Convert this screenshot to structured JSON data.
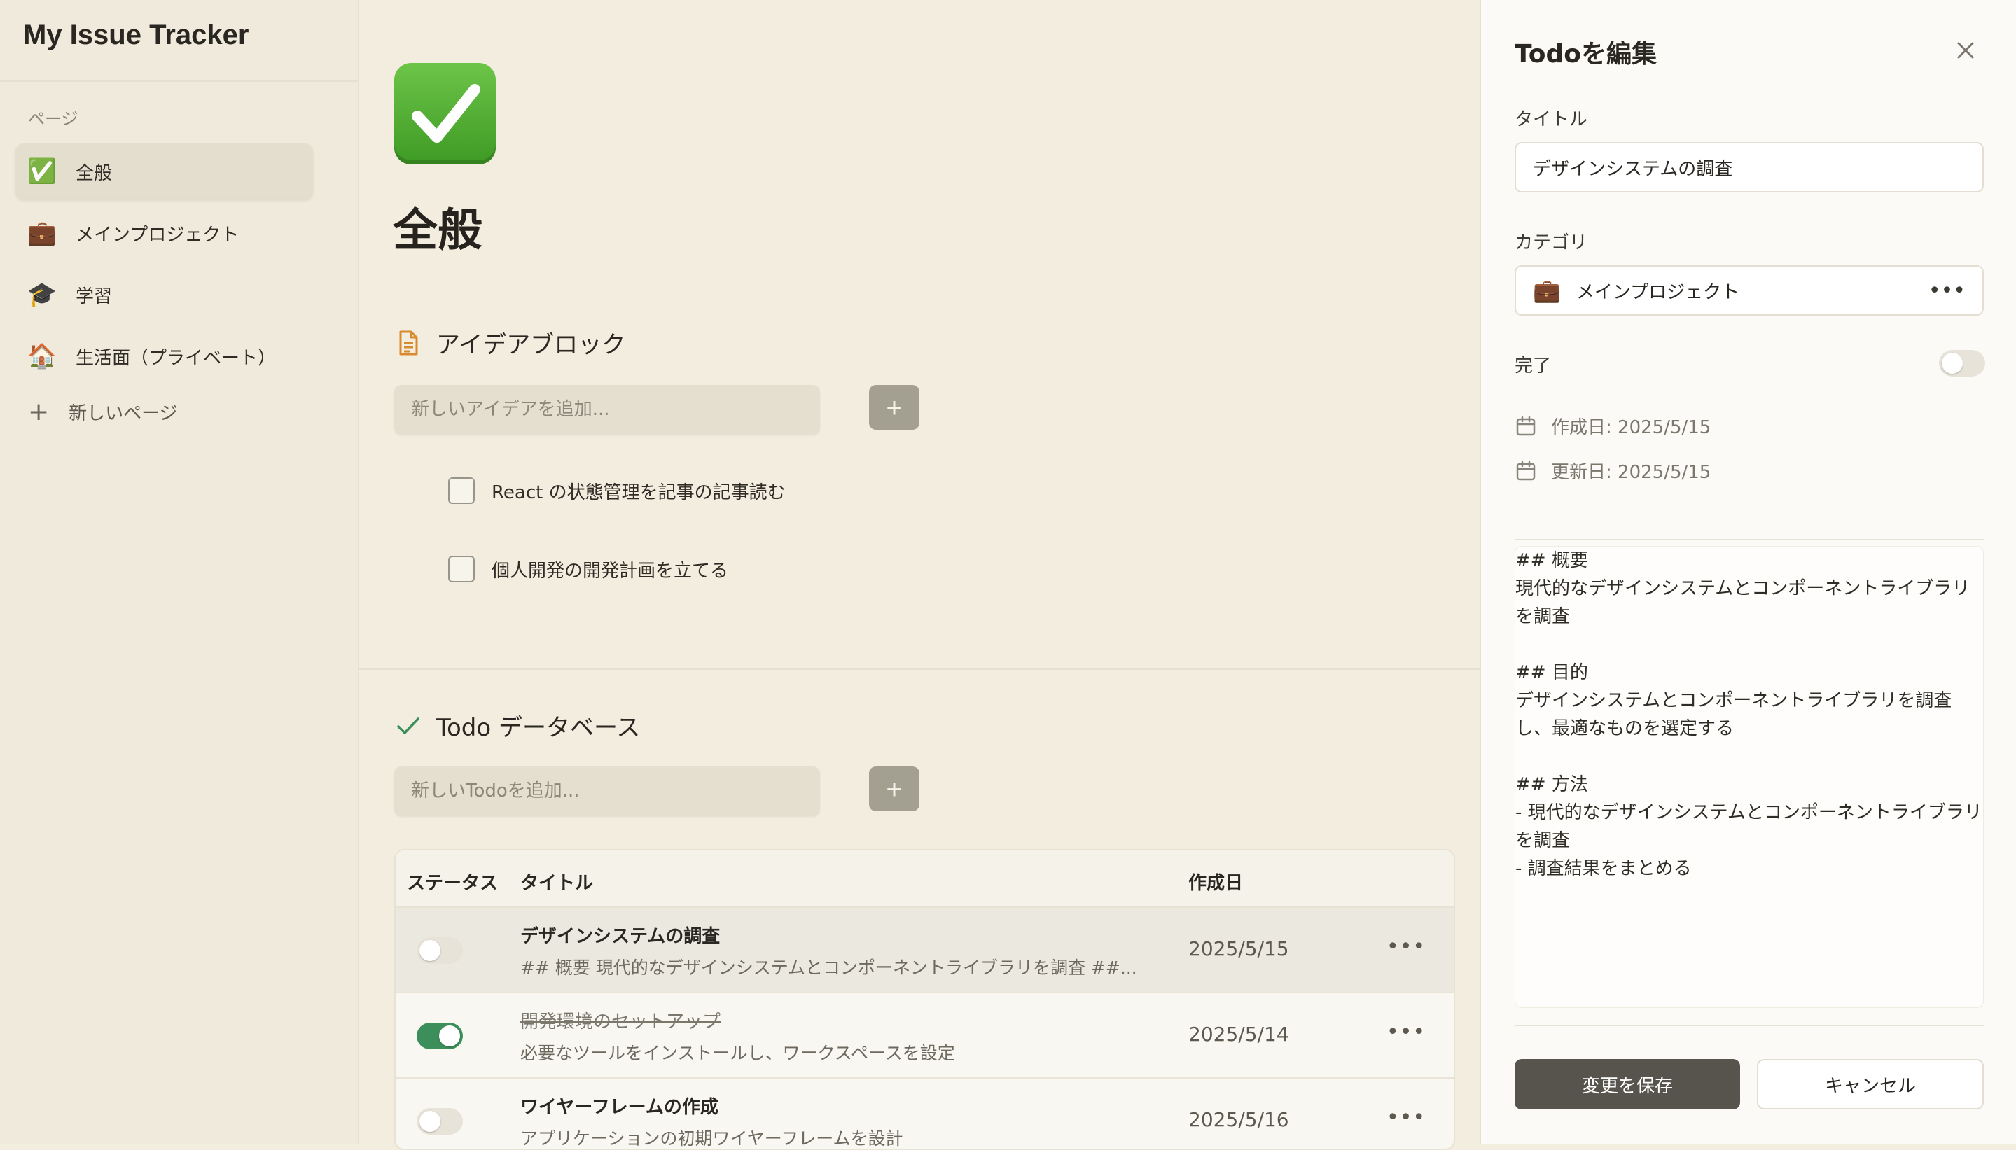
{
  "app": {
    "title": "My Issue Tracker"
  },
  "sidebar": {
    "section_label": "ページ",
    "items": [
      {
        "emoji": "✅",
        "label": "全般"
      },
      {
        "emoji": "💼",
        "label": "メインプロジェクト"
      },
      {
        "emoji": "🎓",
        "label": "学習"
      },
      {
        "emoji": "🏠",
        "label": "生活面（プライベート）"
      }
    ],
    "new_page_label": "新しいページ"
  },
  "main": {
    "page_emoji": "✅",
    "page_title": "全般",
    "idea_block": {
      "title": "アイデアブロック",
      "input_placeholder": "新しいアイデアを追加...",
      "items": [
        "React の状態管理を記事の記事読む",
        "個人開発の開発計画を立てる"
      ]
    },
    "todo_db": {
      "title": "Todo データベース",
      "input_placeholder": "新しいTodoを追加...",
      "columns": {
        "status": "ステータス",
        "title": "タイトル",
        "created": "作成日"
      },
      "rows": [
        {
          "title": "デザインシステムの調査",
          "description": "## 概要 現代的なデザインシステムとコンポーネントライブラリを調査 ##...",
          "created": "2025/5/15",
          "done": false
        },
        {
          "title": "開発環境のセットアップ",
          "description": "必要なツールをインストールし、ワークスペースを設定",
          "created": "2025/5/14",
          "done": true
        },
        {
          "title": "ワイヤーフレームの作成",
          "description": "アプリケーションの初期ワイヤーフレームを設計",
          "created": "2025/5/16",
          "done": false
        }
      ]
    }
  },
  "edit_panel": {
    "title": "Todoを編集",
    "title_label": "タイトル",
    "title_value": "デザインシステムの調査",
    "category_label": "カテゴリ",
    "category_emoji": "💼",
    "category_value": "メインプロジェクト",
    "done_label": "完了",
    "done": false,
    "created_text": "作成日: 2025/5/15",
    "updated_text": "更新日: 2025/5/15",
    "description": "## 概要\n現代的なデザインシステムとコンポーネントライブラリ\nを調査\n\n## 目的\nデザインシステムとコンポーネントライブラリを調査\nし、最適なものを選定する\n\n## 方法\n- 現代的なデザインシステムとコンポーネントライブラリ\nを調査\n- 調査結果をまとめる",
    "save_label": "変更を保存",
    "cancel_label": "キャンセル"
  },
  "colors": {
    "background": "#f2eddf",
    "toggle_on": "#3c8f5a",
    "save_button": "#57544d",
    "add_button": "#a4a091"
  }
}
